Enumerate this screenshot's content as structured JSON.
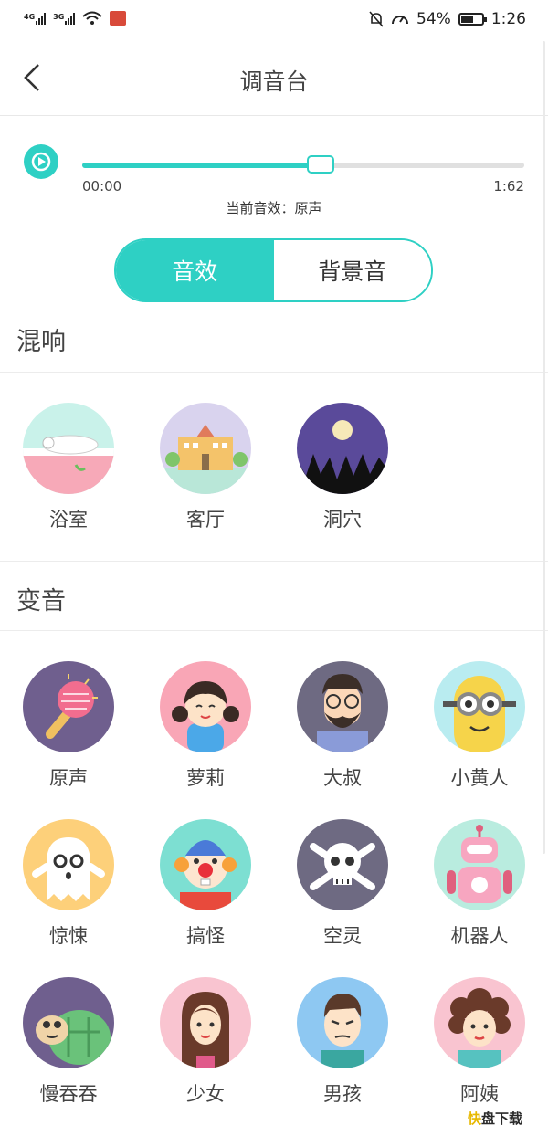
{
  "status_bar": {
    "net1": "4G",
    "net2": "3G",
    "battery": "54%",
    "time": "1:26"
  },
  "header": {
    "title": "调音台"
  },
  "player": {
    "elapsed": "00:00",
    "duration": "1:62",
    "progress": 0.54,
    "current_effect": "当前音效：原声"
  },
  "tabs": {
    "effects": "音效",
    "background": "背景音",
    "active": "effects"
  },
  "reverb": {
    "title": "混响",
    "items": [
      "浴室",
      "客厅",
      "洞穴"
    ]
  },
  "voice": {
    "title": "变音",
    "items": [
      "原声",
      "萝莉",
      "大叔",
      "小黄人",
      "惊悚",
      "搞怪",
      "空灵",
      "机器人",
      "慢吞吞",
      "少女",
      "男孩",
      "阿姨"
    ]
  },
  "watermark": {
    "k": "快",
    "text": "盘下载"
  },
  "colors": {
    "accent": "#2ed0c4"
  }
}
